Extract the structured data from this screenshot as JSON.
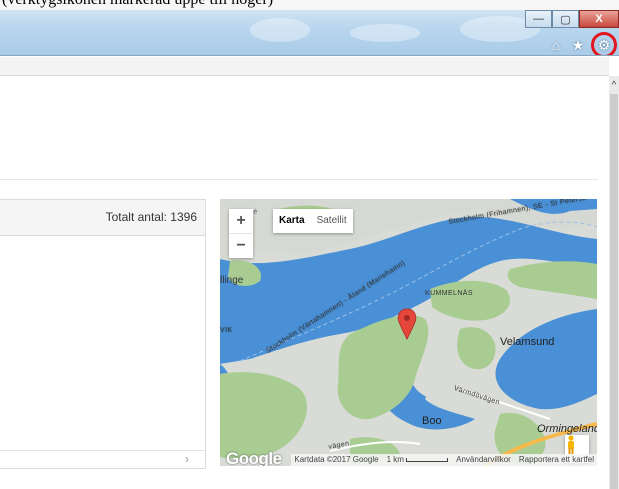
{
  "top_caption": "(verktygsikonen markerad uppe till höger)",
  "window_controls": {
    "minimize": "—",
    "maximize": "▢",
    "close": "X"
  },
  "toolbar_icons": {
    "home": "⌂",
    "favorites": "★",
    "tools": "⚙"
  },
  "list": {
    "total_label": "Totalt antal: 1396",
    "next_arrow": "›"
  },
  "scrollbar": {
    "up_arrow": "^"
  },
  "map": {
    "zoom_in": "+",
    "zoom_out": "−",
    "map_types": [
      "Karta",
      "Satellit"
    ],
    "active_map_type": "Karta",
    "logo": "Google",
    "attribution": {
      "data": "Kartdata ©2017 Google",
      "scale": "1 km",
      "terms": "Användarvillkor",
      "report": "Rapportera ett kartfel"
    },
    "labels": {
      "illinge": "llinge",
      "vik": "VIK",
      "kummelnas": "KUMMELNÄS",
      "velamsund": "Velamsund",
      "boo": "Boo",
      "orminge": "Ormingelande",
      "route_frihamnen": "Stockholm (Frihamnen), SE - St Petersb",
      "route_vartahamnen": "Stockholm (Värtahamnen) - Åland (Mariehamn)",
      "varmdovagen": "Värmdövägen",
      "vagen": "vägen",
      "svage": "svägé"
    },
    "colors": {
      "water": "#4a90d6",
      "land": "#d9dcd6",
      "green": "#a9cc93",
      "road": "#f6b94b",
      "marker": "#e5483b"
    }
  }
}
